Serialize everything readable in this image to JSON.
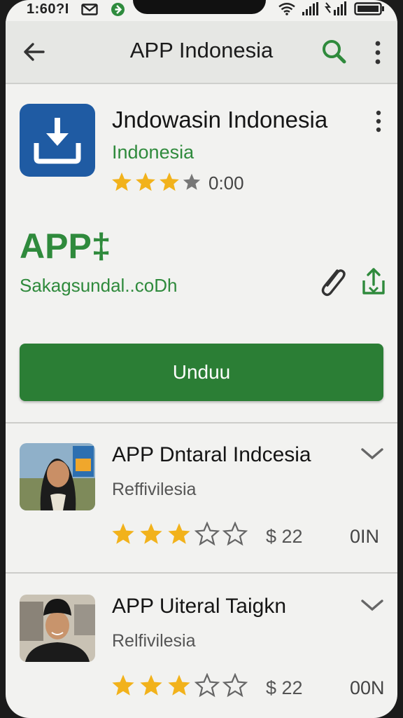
{
  "status_bar": {
    "time": "1:60?I",
    "icons": [
      "mail-icon",
      "g-icon",
      "wifi-icon",
      "signal-icon",
      "signal-icon",
      "battery-icon"
    ]
  },
  "app_bar": {
    "title": "APP Indonesia",
    "icons": [
      "back-arrow-icon",
      "search-icon",
      "more-vert-icon"
    ],
    "accent": "#2f8a3c"
  },
  "app": {
    "name": "Jndowasin Indonesia",
    "region": "Indonesia",
    "rating_value": "0:00",
    "stars": 3,
    "big_label": "APP‡",
    "developer_site": "Sakagsundal..coDh",
    "install_label": "Unduu",
    "logo_color": "#1f5ba3",
    "install_color": "#2b7e35"
  },
  "related": [
    {
      "title": "APP Dntaral Indcesia",
      "developer": "Reffivilesia",
      "stars": 3,
      "price": "$ 22",
      "size": "0IN"
    },
    {
      "title": "APP Uiteral Taigkn",
      "developer": "Relfivilesia",
      "stars": 3,
      "price": "$ 22",
      "size": "00N"
    }
  ],
  "colors": {
    "star": "#f2b21b",
    "star_empty": "#777777"
  }
}
